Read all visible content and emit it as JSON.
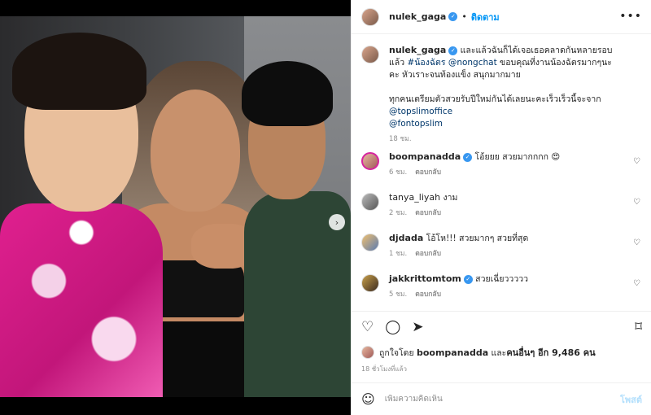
{
  "post": {
    "author": "nulek_gaga",
    "follow_label": "ติดตาม",
    "caption_parts": {
      "text1": " และแล้วฉันก็ได้เจอเธอคลาดกันหลายรอบแล้ว ",
      "tag1": "#น้องฉัตร",
      "mention1": "@nongchat",
      "text2": " ขอบคุณที่งานน้องฉัตรมากๆนะคะ หัวเราะจนท้องแข็ง สนุกมากมาย",
      "text3": "ทุกคนเตรียมตัวสวยรับปีใหม่กันได้เลยนะคะเร็วเร็วนี้จะจาก",
      "mention2": "@topslimoffice",
      "mention3": "@fontopslim"
    },
    "caption_time": "18 ชม.",
    "liked_by_prefix": "ถูกใจโดย ",
    "liked_by_user": "boompanadda",
    "liked_by_mid": " และ",
    "liked_by_others": "คนอื่นๆ อีก 9,486 คน",
    "time_ago": "18 ชั่วโมงที่แล้ว"
  },
  "comments": [
    {
      "user": "boompanadda",
      "verified": true,
      "text": " โอ้ยยย สวยมากกกก 😍",
      "time": "6 ชม.",
      "reply": "ตอบกลับ"
    },
    {
      "user": "tanya_liyah",
      "verified": false,
      "text": " งาม",
      "time": "2 ชม.",
      "reply": "ตอบกลับ"
    },
    {
      "user": "djdada",
      "verified": false,
      "text": " โอ้โห!!! สวยมากๆ สวยที่สุด",
      "time": "1 ชม.",
      "reply": "ตอบกลับ"
    },
    {
      "user": "jakkrittomtom",
      "verified": true,
      "text": " สวยเฉี่ยววววว",
      "time": "5 ชม.",
      "reply": "ตอบกลับ"
    }
  ],
  "compose": {
    "placeholder": "เพิ่มความคิดเห็น",
    "post_label": "โพสต์"
  },
  "icons": {
    "verified": "verified-badge-icon",
    "heart": "heart-icon",
    "comment": "comment-icon",
    "share": "share-icon",
    "bookmark": "bookmark-icon",
    "emoji": "emoji-icon",
    "more": "more-options-icon",
    "next": "chevron-right-icon"
  },
  "colors": {
    "accent": "#0095f6",
    "verified": "#3897f0",
    "link": "#00376b",
    "muted": "#8e8e8e"
  }
}
